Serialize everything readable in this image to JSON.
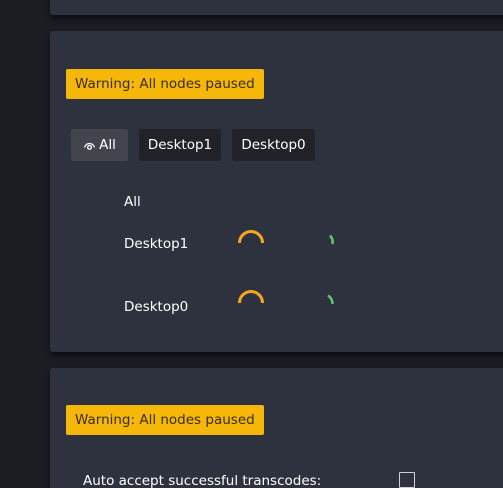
{
  "nodes_panel": {
    "warning": "Warning: All nodes paused",
    "tabs": [
      {
        "label": "All",
        "icon": "eye-icon"
      },
      {
        "label": "Desktop1"
      },
      {
        "label": "Desktop0"
      }
    ],
    "node_rows": [
      {
        "label": "All"
      },
      {
        "label": "Desktop1",
        "gauges": [
          {
            "icon": "orange-arc-gauge",
            "color": "#f5a623"
          },
          {
            "icon": "green-arc-gauge",
            "color": "#5fc56b"
          }
        ]
      },
      {
        "label": "Desktop0",
        "gauges": [
          {
            "icon": "orange-arc-gauge",
            "color": "#f5a623"
          },
          {
            "icon": "green-arc-gauge",
            "color": "#5fc56b"
          }
        ]
      }
    ]
  },
  "settings_panel": {
    "warning": "Warning: All nodes paused",
    "auto_accept_label": "Auto accept successful transcodes:",
    "auto_accept_checked": false
  },
  "colors": {
    "background": "#1c1d23",
    "card": "#2e323e",
    "warning": "#f5b70a",
    "tab": "#222329",
    "tab_active": "#42454e"
  }
}
